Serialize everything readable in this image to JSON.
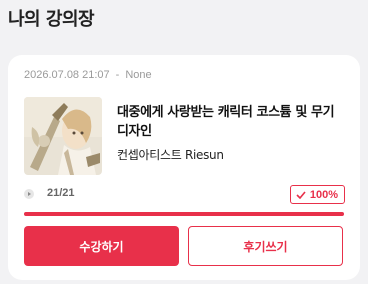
{
  "page": {
    "title": "나의 강의장"
  },
  "course": {
    "date": "2026.07.08 21:07",
    "separator": "-",
    "status": "None",
    "title": "대중에게 사랑받는 캐릭터 코스튬 및 무기 디자인",
    "instructor": "컨셉아티스트 Riesun",
    "thumbnail_icon": "character-illustration-thumbnail",
    "progress_count": "21/21",
    "progress_percent_label": "100%",
    "progress_fraction": 1.0
  },
  "buttons": {
    "primary_label": "수강하기",
    "secondary_label": "후기쓰기"
  },
  "colors": {
    "accent": "#e8304a",
    "background": "#f2f2f4",
    "card": "#ffffff"
  }
}
